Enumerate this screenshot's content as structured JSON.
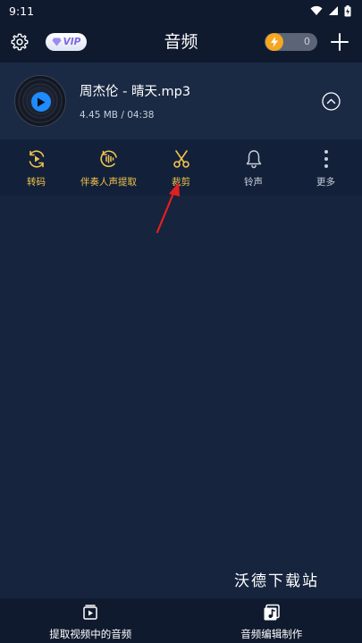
{
  "status_bar": {
    "time": "9:11",
    "icons": [
      "wifi-icon",
      "cellular-signal-icon",
      "battery-charging-icon"
    ]
  },
  "app_bar": {
    "title": "音频",
    "vip_label": "VIP",
    "coin_count": "0",
    "icons": [
      "gear-icon",
      "diamond-icon",
      "lightning-coin-icon",
      "plus-icon"
    ]
  },
  "file": {
    "name": "周杰伦 - 晴天.mp3",
    "meta": "4.45 MB / 04:38",
    "icons": [
      "vinyl-disc-icon",
      "play-icon",
      "chevron-up-icon"
    ]
  },
  "actions": [
    {
      "label": "转码",
      "icon": "convert-icon"
    },
    {
      "label": "伴奏人声提取",
      "icon": "vocal-extract-icon"
    },
    {
      "label": "裁剪",
      "icon": "scissors-icon"
    },
    {
      "label": "铃声",
      "icon": "bell-icon"
    },
    {
      "label": "更多",
      "icon": "more-vertical-icon"
    }
  ],
  "watermark": "沃德下载站",
  "bottom_nav": [
    {
      "label": "提取视频中的音频",
      "icon": "video-play-icon"
    },
    {
      "label": "音频编辑制作",
      "icon": "music-note-icon"
    }
  ],
  "colors": {
    "background": "#17243d",
    "bar_background": "#101a2e",
    "card_background": "#1b2a44",
    "action_bar_background": "#13203a",
    "accent_gold": "#f0c44c",
    "accent_blue": "#1e8bff",
    "coin_orange": "#f5a623",
    "annotation_red": "#e02020"
  }
}
